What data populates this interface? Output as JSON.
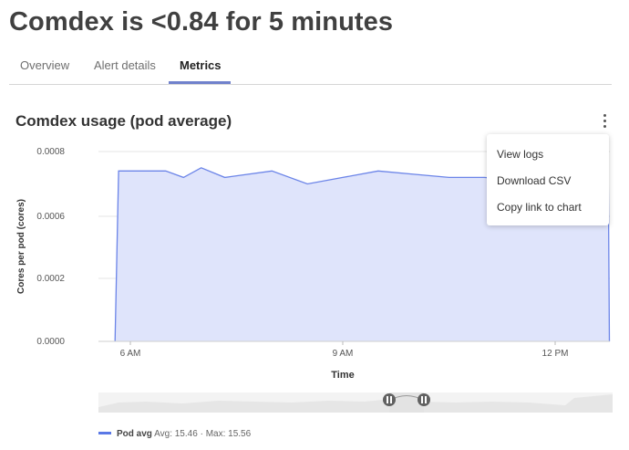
{
  "header": {
    "title": "Comdex is <0.84 for 5 minutes"
  },
  "tabs": [
    {
      "label": "Overview",
      "active": false
    },
    {
      "label": "Alert details",
      "active": false
    },
    {
      "label": "Metrics",
      "active": true
    }
  ],
  "chart_panel": {
    "title": "Comdex usage (pod average)",
    "menu": {
      "items": [
        {
          "label": "View logs"
        },
        {
          "label": "Download CSV"
        },
        {
          "label": "Copy link to chart"
        }
      ]
    }
  },
  "chart_data": {
    "type": "area",
    "title": "Comdex usage (pod average)",
    "xlabel": "Time",
    "ylabel": "Cores per pod (cores)",
    "y_ticks": [
      "0.0008",
      "0.0006",
      "0.0002",
      "0.0000"
    ],
    "x_ticks": [
      "6 AM",
      "9 AM",
      "12 PM"
    ],
    "grid": true,
    "series": [
      {
        "name": "Pod avg",
        "x": [
          "05:47",
          "05:50",
          "06:00",
          "06:30",
          "06:45",
          "07:00",
          "07:20",
          "08:00",
          "08:30",
          "09:00",
          "09:30",
          "10:00",
          "10:30",
          "11:00",
          "12:00",
          "12:45",
          "12:46"
        ],
        "values": [
          0.0,
          0.00074,
          0.00074,
          0.00074,
          0.00072,
          0.00075,
          0.00072,
          0.00074,
          0.0007,
          0.00072,
          0.00074,
          0.00073,
          0.00072,
          0.00072,
          0.0007,
          0.00072,
          0.0
        ]
      }
    ],
    "legend": [
      {
        "name": "Pod avg",
        "avg_label": "Avg: 15.46",
        "separator": "·",
        "max_label": "Max: 15.56"
      }
    ],
    "colors": {
      "line": "#6b84e8",
      "fill": "#dfe4fb",
      "grid": "#e6e6e6"
    }
  }
}
